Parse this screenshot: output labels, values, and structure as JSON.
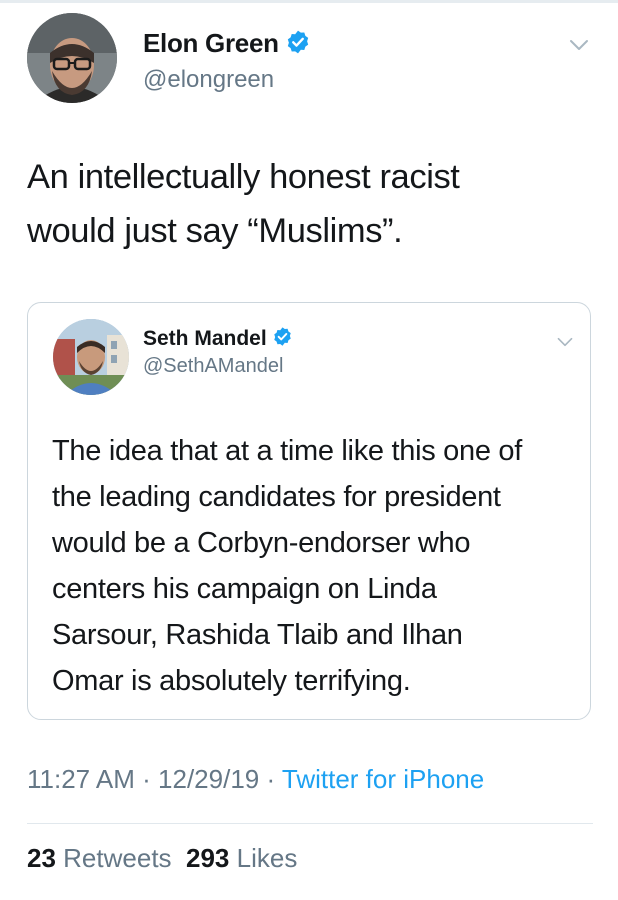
{
  "tweet": {
    "author": {
      "name": "Elon Green",
      "handle": "@elongreen",
      "verified": true,
      "avatar_icon": "person-glasses-beard-avatar"
    },
    "text": "An intellectually honest racist\nwould just say “Muslims”.",
    "timestamp": "11:27 AM · 12/29/19 ·",
    "source": "Twitter for iPhone",
    "retweets_count": "23",
    "retweets_label": "Retweets",
    "likes_count": "293",
    "likes_label": "Likes"
  },
  "quoted_tweet": {
    "author": {
      "name": "Seth Mandel",
      "handle": "@SethAMandel",
      "verified": true,
      "avatar_icon": "person-avatar"
    },
    "text": "The idea that at a time like this one of\nthe leading candidates for president\nwould be a Corbyn-endorser who\ncenters his campaign on Linda\nSarsour, Rashida Tlaib and Ilhan\nOmar is absolutely terrifying."
  },
  "colors": {
    "verified_badge": "#1da1f2",
    "link": "#1da1f2",
    "secondary_text": "#657786",
    "primary_text": "#14171a",
    "border": "#ccd6dd"
  }
}
